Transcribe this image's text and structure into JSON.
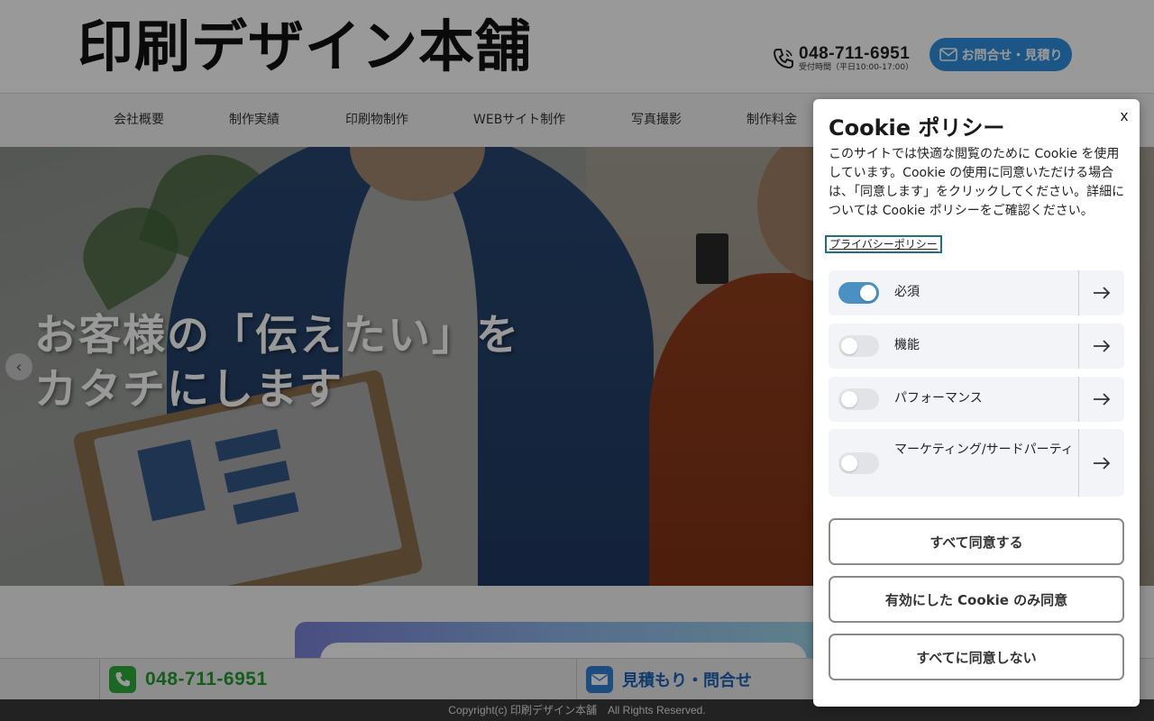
{
  "site": {
    "logo_text": "印刷デザイン本舗",
    "phone": "048-711-6951",
    "phone_hours": "受付時間（平日10:00-17:00）",
    "contact_button_label": "お問合せ・見積り"
  },
  "nav": {
    "items": [
      {
        "label": "会社概要"
      },
      {
        "label": "制作実績"
      },
      {
        "label": "印刷物制作"
      },
      {
        "label": "WEBサイト制作"
      },
      {
        "label": "写真撮影"
      },
      {
        "label": "制作料金"
      }
    ]
  },
  "hero": {
    "title_line1": "お客様の「伝えたい」を",
    "title_line2": "カタチにします",
    "prev_arrow": "‹"
  },
  "footer": {
    "phone": "048-711-6951",
    "mail_label": "見積もり・問合せ",
    "copyright": "Copyright(c) 印刷デザイン本舗　All Rights Reserved."
  },
  "cookie": {
    "title": "Cookie ポリシー",
    "close_label": "x",
    "description": "このサイトでは快適な閲覧のために Cookie を使用しています。Cookie の使用に同意いただける場合は、「同意します」をクリックしてください。詳細については Cookie ポリシーをご確認ください。",
    "privacy_link": "プライバシーポリシー",
    "categories": [
      {
        "label": "必須",
        "enabled": true
      },
      {
        "label": "機能",
        "enabled": false
      },
      {
        "label": "パフォーマンス",
        "enabled": false
      },
      {
        "label": "マーケティング/サードパーティ",
        "enabled": false
      }
    ],
    "buttons": {
      "accept_all": "すべて同意する",
      "accept_selected": "有効にした Cookie のみ同意",
      "reject_all": "すべてに同意しない"
    }
  },
  "colors": {
    "accent_blue": "#2f8fe0",
    "toggle_on": "#4a90c2",
    "footer_phone_green": "#239b2f",
    "focus_outline": "#1d6f86"
  }
}
